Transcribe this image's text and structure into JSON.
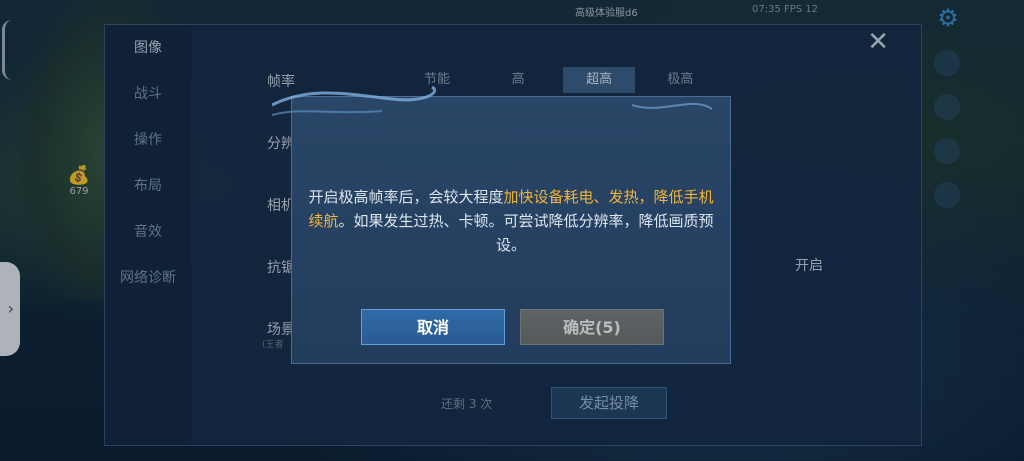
{
  "hud": {
    "opponent_name": "高级体验服d6",
    "status_text": "07:35   FPS 12",
    "gold_value": "679"
  },
  "settings": {
    "tabs": [
      "图像",
      "战斗",
      "操作",
      "布局",
      "音效",
      "网络诊断"
    ],
    "rows": {
      "frame_rate": "帧率",
      "resolution": "分辨",
      "camera": "相机",
      "anti_alias": "抗锯",
      "scene": "场景",
      "scene_sub": "(王者"
    },
    "frame_options": [
      "节能",
      "高",
      "超高",
      "极高"
    ],
    "selected_frame_option": "超高",
    "toggle_on": "开启",
    "remaining_text": "还剩 3 次",
    "surrender_button": "发起投降"
  },
  "dialog": {
    "message_part1": "开启极高帧率后，会较大程度",
    "message_highlight1": "加快设备耗电、发热，降低手机续航",
    "message_part2": "。如果发生过热、卡顿。可尝试降低分辨率，降低画质预设。",
    "cancel_label": "取消",
    "confirm_label": "确定(5)"
  },
  "colors": {
    "highlight": "#f2b43a",
    "primary_button": "#2f6aa8",
    "disabled_button": "#5f6566"
  }
}
